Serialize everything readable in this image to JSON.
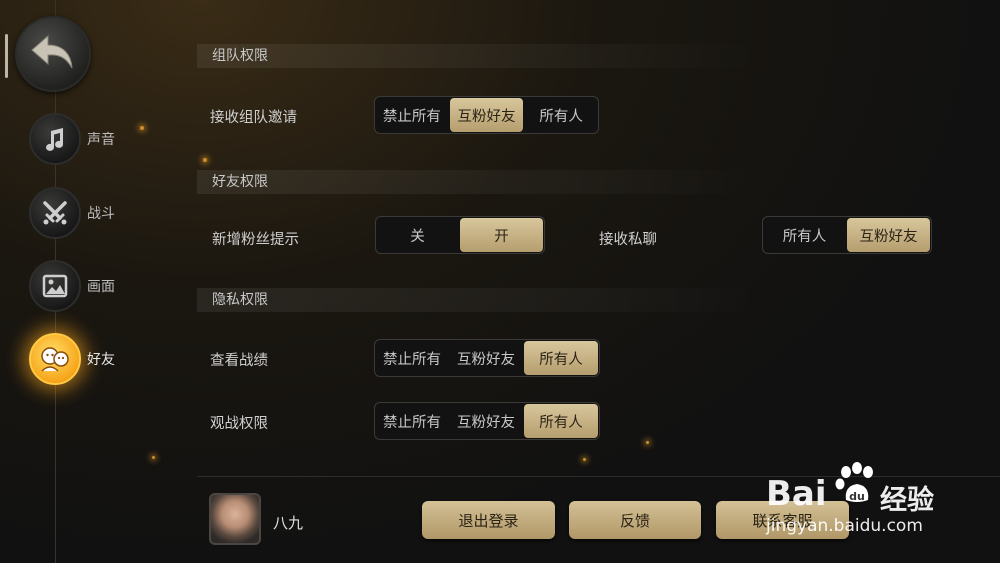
{
  "nav": {
    "items": [
      {
        "label": "声音",
        "icon": "music-note-icon"
      },
      {
        "label": "战斗",
        "icon": "crossed-swords-icon"
      },
      {
        "label": "画面",
        "icon": "picture-icon"
      },
      {
        "label": "好友",
        "icon": "friends-icon",
        "active": true
      }
    ]
  },
  "sections": {
    "team": {
      "title": "组队权限",
      "invite": {
        "label": "接收组队邀请",
        "options": [
          "禁止所有",
          "互粉好友",
          "所有人"
        ],
        "selected": "互粉好友"
      }
    },
    "friends": {
      "title": "好友权限",
      "new_fan": {
        "label": "新增粉丝提示",
        "options": [
          "关",
          "开"
        ],
        "selected": "开"
      },
      "private_msg": {
        "label": "接收私聊",
        "options": [
          "所有人",
          "互粉好友"
        ],
        "selected": "互粉好友"
      }
    },
    "privacy": {
      "title": "隐私权限",
      "record": {
        "label": "查看战绩",
        "options": [
          "禁止所有",
          "互粉好友",
          "所有人"
        ],
        "selected": "所有人"
      },
      "spectate": {
        "label": "观战权限",
        "options": [
          "禁止所有",
          "互粉好友",
          "所有人"
        ],
        "selected": "所有人"
      }
    }
  },
  "footer": {
    "username": "八九",
    "logout_label": "退出登录",
    "feedback_label": "反馈",
    "support_label": "联系客服"
  },
  "watermark": {
    "brand": "Bai",
    "brand_suffix": "经验",
    "url": "jingyan.baidu.com"
  },
  "colors": {
    "accent": "#c8b282",
    "active_glow": "#f7a51a",
    "background": "#111111"
  }
}
